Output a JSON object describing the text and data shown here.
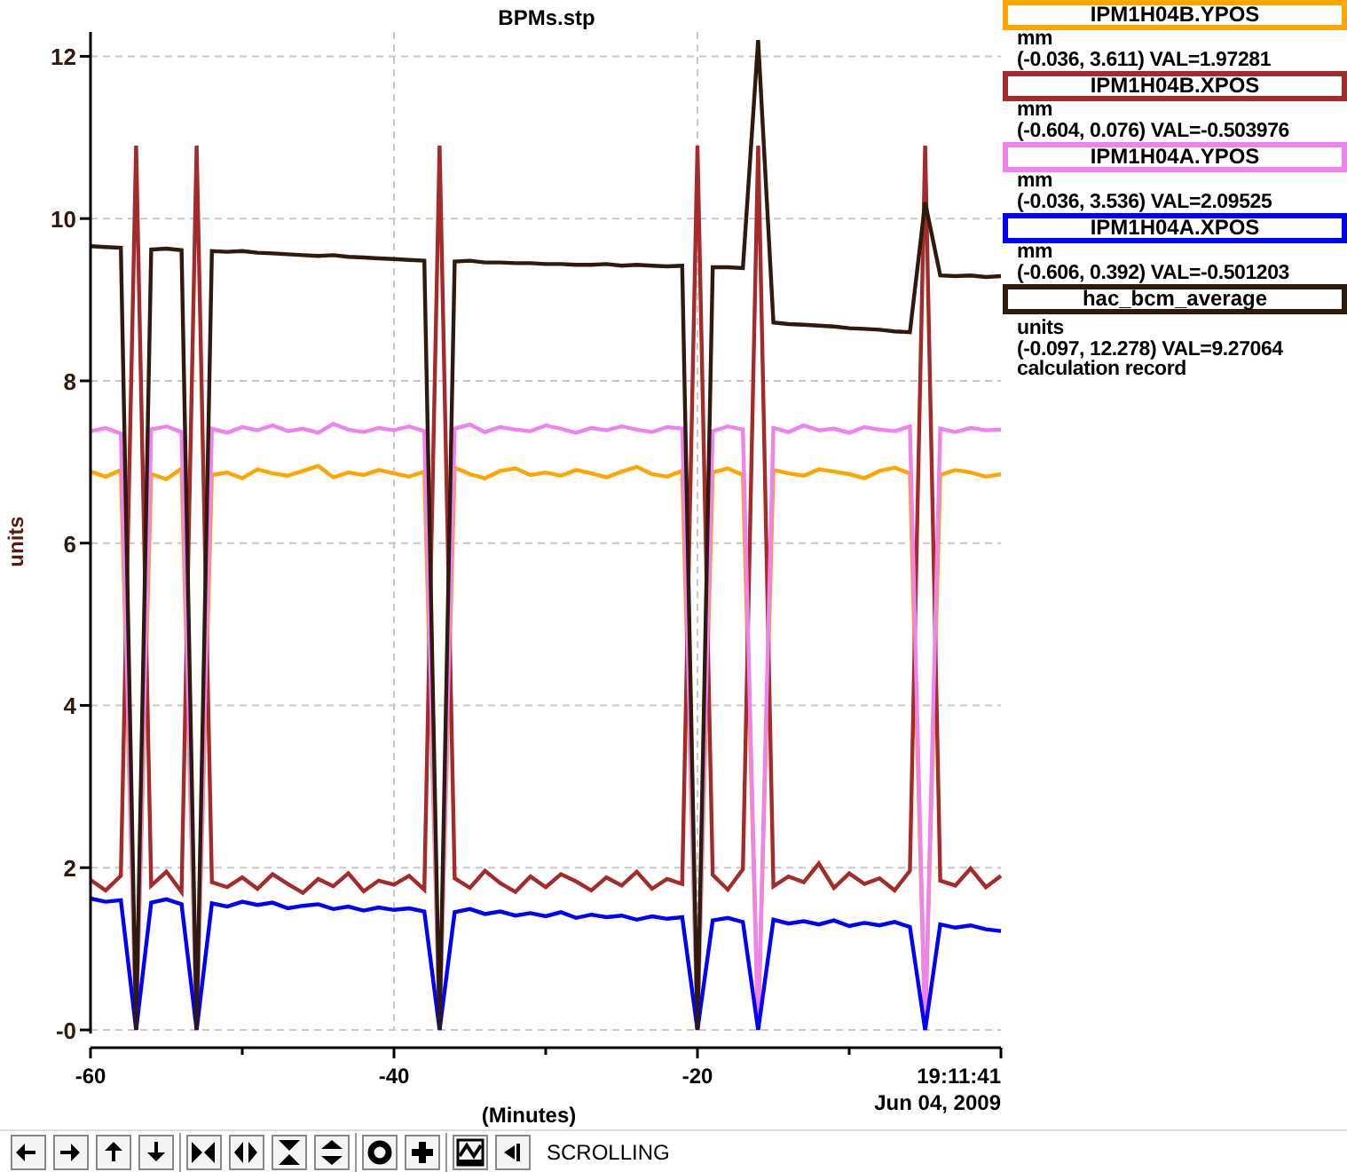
{
  "plot": {
    "time": "19:11:41",
    "date": "Jun 04, 2009",
    "chart_data": {
      "type": "line",
      "title": "BPMs.stp",
      "xlabel": "(Minutes)",
      "ylabel": "units",
      "xlim": [
        -60,
        0
      ],
      "ylim": [
        0,
        12.3
      ],
      "grid": true,
      "xticks": [
        -60,
        -40,
        -20
      ],
      "yticks": [
        {
          "value": 0,
          "label": "-0"
        },
        2,
        4,
        6,
        8,
        10,
        12
      ],
      "x": [
        -60,
        -59,
        -58,
        -57,
        -56,
        -55,
        -54,
        -53,
        -52,
        -51,
        -50,
        -49,
        -48,
        -47,
        -46,
        -45,
        -44,
        -43,
        -42,
        -41,
        -40,
        -39,
        -38,
        -37,
        -36,
        -35,
        -34,
        -33,
        -32,
        -31,
        -30,
        -29,
        -28,
        -27,
        -26,
        -25,
        -24,
        -23,
        -22,
        -21,
        -20,
        -19,
        -18,
        -17,
        -16,
        -15,
        -14,
        -13,
        -12,
        -11,
        -10,
        -9,
        -8,
        -7,
        -6,
        -5,
        -4,
        -3,
        -2,
        -1,
        0
      ],
      "series": [
        {
          "name": "IPM1H04B.YPOS",
          "color": "#ffa500",
          "values": [
            6.88,
            6.82,
            6.9,
            0,
            6.85,
            6.79,
            6.92,
            0,
            6.84,
            6.87,
            6.8,
            6.91,
            6.86,
            6.83,
            6.89,
            6.95,
            6.81,
            6.87,
            6.84,
            6.9,
            6.86,
            6.82,
            6.88,
            0,
            6.93,
            6.85,
            6.8,
            6.89,
            6.92,
            6.84,
            6.87,
            6.83,
            6.9,
            6.86,
            6.81,
            6.88,
            6.94,
            6.85,
            6.82,
            6.89,
            0,
            6.87,
            6.92,
            6.84,
            0,
            6.9,
            6.86,
            6.83,
            6.91,
            6.88,
            6.85,
            6.8,
            6.89,
            6.93,
            6.86,
            0,
            6.84,
            6.9,
            6.87,
            6.82,
            6.85
          ]
        },
        {
          "name": "IPM1H04B.XPOS",
          "color": "#a52a2a",
          "values": [
            1.85,
            1.72,
            1.9,
            10.9,
            1.78,
            1.95,
            1.7,
            10.9,
            1.82,
            1.76,
            1.88,
            1.74,
            1.92,
            1.8,
            1.69,
            1.86,
            1.77,
            1.93,
            1.71,
            1.84,
            1.79,
            1.9,
            1.73,
            10.9,
            1.87,
            1.75,
            1.96,
            1.81,
            1.7,
            1.89,
            1.76,
            1.92,
            1.83,
            1.72,
            1.88,
            1.78,
            1.95,
            1.74,
            1.86,
            1.8,
            10.9,
            1.91,
            1.73,
            1.98,
            10.9,
            1.77,
            1.89,
            1.82,
            2.05,
            1.75,
            1.93,
            1.8,
            1.87,
            1.72,
            1.96,
            10.9,
            1.84,
            1.78,
            1.99,
            1.76,
            1.9
          ]
        },
        {
          "name": "IPM1H04A.YPOS",
          "color": "#ee82ee",
          "values": [
            7.38,
            7.42,
            7.35,
            0,
            7.4,
            7.44,
            7.37,
            0,
            7.41,
            7.36,
            7.43,
            7.39,
            7.45,
            7.38,
            7.41,
            7.36,
            7.47,
            7.4,
            7.37,
            7.42,
            7.39,
            7.44,
            7.38,
            0,
            7.41,
            7.46,
            7.37,
            7.43,
            7.4,
            7.38,
            7.45,
            7.41,
            7.36,
            7.42,
            7.39,
            7.44,
            7.4,
            7.37,
            7.43,
            7.41,
            0,
            7.38,
            7.44,
            7.4,
            0,
            7.42,
            7.37,
            7.45,
            7.39,
            7.41,
            7.36,
            7.43,
            7.4,
            7.38,
            7.44,
            0,
            7.41,
            7.37,
            7.42,
            7.39,
            7.4
          ]
        },
        {
          "name": "IPM1H04A.XPOS",
          "color": "#0000ff",
          "values": [
            1.62,
            1.58,
            1.6,
            0,
            1.57,
            1.61,
            1.55,
            0,
            1.56,
            1.52,
            1.58,
            1.54,
            1.57,
            1.5,
            1.53,
            1.55,
            1.49,
            1.52,
            1.47,
            1.51,
            1.48,
            1.5,
            1.46,
            0,
            1.45,
            1.49,
            1.43,
            1.46,
            1.41,
            1.44,
            1.4,
            1.45,
            1.38,
            1.42,
            1.39,
            1.41,
            1.36,
            1.4,
            1.37,
            1.39,
            0,
            1.35,
            1.38,
            1.33,
            0,
            1.36,
            1.31,
            1.34,
            1.3,
            1.35,
            1.28,
            1.32,
            1.29,
            1.33,
            1.27,
            0,
            1.3,
            1.26,
            1.29,
            1.24,
            1.22
          ]
        },
        {
          "name": "hac_bcm_average",
          "color": "#2e1a0e",
          "values": [
            9.66,
            9.65,
            9.64,
            0,
            9.62,
            9.63,
            9.61,
            0,
            9.6,
            9.59,
            9.6,
            9.58,
            9.57,
            9.56,
            9.55,
            9.54,
            9.55,
            9.53,
            9.52,
            9.51,
            9.5,
            9.49,
            9.48,
            0,
            9.47,
            9.48,
            9.46,
            9.46,
            9.45,
            9.45,
            9.44,
            9.44,
            9.43,
            9.43,
            9.44,
            9.42,
            9.43,
            9.42,
            9.41,
            9.42,
            0,
            9.4,
            9.4,
            9.39,
            12.2,
            8.72,
            8.7,
            8.69,
            8.68,
            8.67,
            8.65,
            8.64,
            8.63,
            8.61,
            8.6,
            10.2,
            9.3,
            9.29,
            9.3,
            9.28,
            9.29
          ]
        }
      ]
    }
  },
  "legend": [
    {
      "units": "mm",
      "reading": "(-0.036, 3.611) VAL=1.97281"
    },
    {
      "units": "mm",
      "reading": "(-0.604, 0.076) VAL=-0.503976"
    },
    {
      "units": "mm",
      "reading": "(-0.036, 3.536) VAL=2.09525"
    },
    {
      "units": "mm",
      "reading": "(-0.606, 0.392) VAL=-0.501203"
    },
    {
      "units": "units",
      "reading": "(-0.097, 12.278) VAL=9.27064",
      "note": "calculation record"
    }
  ],
  "toolbar": {
    "groups": [
      [
        {
          "kind": "left"
        },
        {
          "kind": "right"
        },
        {
          "kind": "up"
        },
        {
          "kind": "down"
        }
      ],
      [
        {
          "kind": "zoom-in-x"
        },
        {
          "kind": "zoom-out-x"
        },
        {
          "kind": "zoom-in-y"
        },
        {
          "kind": "zoom-out-y"
        }
      ],
      [
        {
          "kind": "circle"
        },
        {
          "kind": "plus"
        }
      ],
      [
        {
          "kind": "graph"
        },
        {
          "kind": "back"
        }
      ]
    ],
    "mode": "SCROLLING"
  }
}
